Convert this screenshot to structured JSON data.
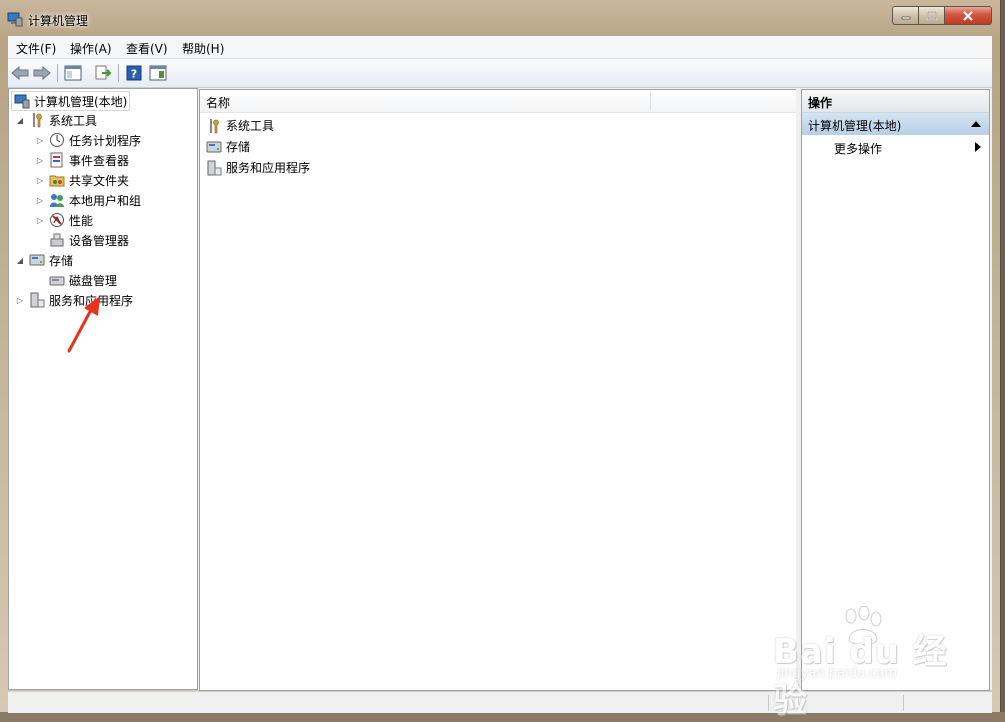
{
  "window": {
    "title": "计算机管理"
  },
  "menu": [
    {
      "label": "文件(F)"
    },
    {
      "label": "操作(A)"
    },
    {
      "label": "查看(V)"
    },
    {
      "label": "帮助(H)"
    }
  ],
  "toolbar": {
    "icons": [
      "back-arrow-icon",
      "forward-arrow-icon",
      "show-hide-tree-icon",
      "export-list-icon",
      "help-icon",
      "show-hide-action-pane-icon"
    ]
  },
  "tree": {
    "root": "计算机管理(本地)",
    "system_tools": "系统工具",
    "task_scheduler": "任务计划程序",
    "event_viewer": "事件查看器",
    "shared_folders": "共享文件夹",
    "local_users": "本地用户和组",
    "performance": "性能",
    "device_manager": "设备管理器",
    "storage": "存储",
    "disk_management": "磁盘管理",
    "services_apps": "服务和应用程序"
  },
  "list": {
    "column_name": "名称",
    "rows": [
      "系统工具",
      "存储",
      "服务和应用程序"
    ]
  },
  "actions": {
    "header": "操作",
    "section": "计算机管理(本地)",
    "more": "更多操作"
  },
  "watermark": {
    "brand": "Bai du 经验",
    "url": "jingyan.baidu.com"
  },
  "colors": {
    "accent_red": "#e8321e",
    "action_section": "#c6d9ec"
  }
}
